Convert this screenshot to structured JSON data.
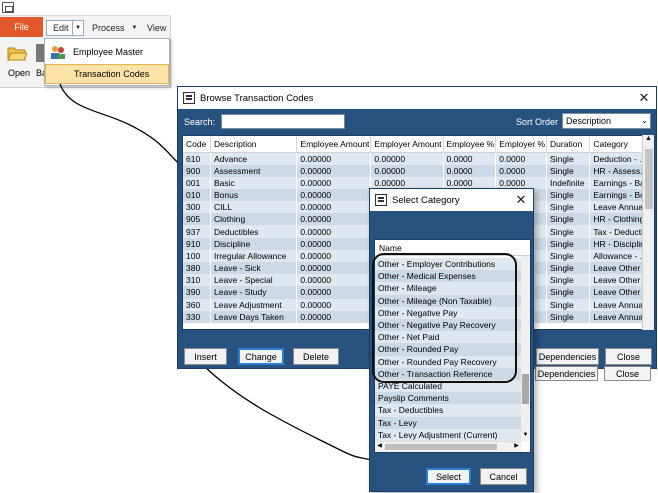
{
  "ribbon": {
    "file_label": "File",
    "tabs": [
      "Edit",
      "Process",
      "View"
    ],
    "open_label": "Open",
    "second_label": "Ba"
  },
  "edit_menu": {
    "items": [
      "Employee Master",
      "Transaction Codes"
    ]
  },
  "main_window": {
    "title": "Browse Transaction Codes",
    "search_label": "Search:",
    "search_value": "",
    "sort_label": "Sort Order",
    "sort_value": "Description",
    "columns": [
      "Code",
      "Description",
      "Employee Amount",
      "Employer Amount",
      "Employee %",
      "Employer %",
      "Duration",
      "Category"
    ],
    "rows": [
      [
        "610",
        "Advance",
        "0.00000",
        "0.00000",
        "0.0000",
        "0.0000",
        "Single",
        "Deduction - ..."
      ],
      [
        "900",
        "Assessment",
        "0.00000",
        "0.00000",
        "0.0000",
        "0.0000",
        "Single",
        "HR - Assess..."
      ],
      [
        "001",
        "Basic",
        "0.00000",
        "0.00000",
        "0.0000",
        "0.0000",
        "Indefinite",
        "Earnings - Ba..."
      ],
      [
        "010",
        "Bonus",
        "0.00000",
        "",
        "",
        "",
        "Single",
        "Earnings - Bo..."
      ],
      [
        "300",
        "CILL",
        "0.00000",
        "",
        "",
        "",
        "Single",
        "Leave Annua..."
      ],
      [
        "905",
        "Clothing",
        "0.00000",
        "",
        "",
        "",
        "Single",
        "HR - Clothing"
      ],
      [
        "937",
        "Deductibles",
        "0.00000",
        "",
        "",
        "",
        "Single",
        "Tax - Deducti..."
      ],
      [
        "910",
        "Discipline",
        "0.00000",
        "",
        "",
        "",
        "Single",
        "HR - Discipline"
      ],
      [
        "100",
        "Irregular Allowance",
        "0.00000",
        "",
        "",
        "",
        "Single",
        "Allowance - ..."
      ],
      [
        "380",
        "Leave - Sick",
        "0.00000",
        "",
        "",
        "",
        "Single",
        "Leave Other ..."
      ],
      [
        "310",
        "Leave - Special",
        "0.00000",
        "",
        "",
        "",
        "Single",
        "Leave Other ..."
      ],
      [
        "390",
        "Leave - Study",
        "0.00000",
        "",
        "",
        "",
        "Single",
        "Leave Other ..."
      ],
      [
        "360",
        "Leave Adjustment",
        "0.00000",
        "",
        "",
        "",
        "Single",
        "Leave Annua..."
      ],
      [
        "330",
        "Leave Days Taken",
        "0.00000",
        "",
        "",
        "",
        "Single",
        "Leave Annua..."
      ]
    ],
    "buttons": {
      "insert": "Insert",
      "change": "Change",
      "delete": "Delete",
      "dependencies": "Dependencies",
      "close": "Close"
    }
  },
  "dialog": {
    "title": "Select Category",
    "column": "Name",
    "items": [
      "Other - Employer Contributions",
      "Other - Medical Expenses",
      "Other - Mileage",
      "Other - Mileage (Non Taxable)",
      "Other - Negative Pay",
      "Other - Negative Pay Recovery",
      "Other - Net Paid",
      "Other - Rounded Pay",
      "Other - Rounded Pay Recovery",
      "Other - Transaction Reference",
      "PAYE Calculated",
      "Payslip Comments",
      "Tax - Deductibles",
      "Tax - Levy",
      "Tax - Levy Adjustment (Current)"
    ],
    "select_label": "Select",
    "cancel_label": "Cancel"
  }
}
